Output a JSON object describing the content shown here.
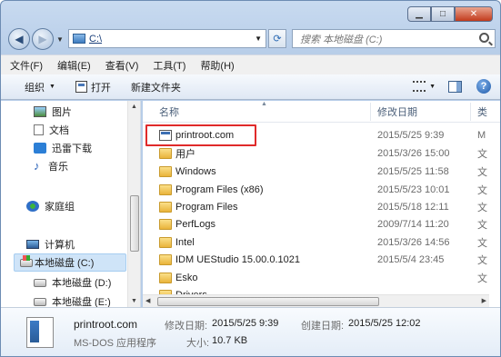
{
  "address": {
    "path": "C:\\"
  },
  "search": {
    "placeholder": "搜索 本地磁盘 (C:)"
  },
  "menu": [
    "文件(F)",
    "编辑(E)",
    "查看(V)",
    "工具(T)",
    "帮助(H)"
  ],
  "commands": {
    "organize": "组织",
    "open": "打开",
    "new_folder": "新建文件夹"
  },
  "nav_items": {
    "pictures": "图片",
    "documents": "文档",
    "xunlei": "迅雷下载",
    "music": "音乐",
    "homegroup": "家庭组",
    "computer": "计算机",
    "drive_c": "本地磁盘 (C:)",
    "drive_d": "本地磁盘 (D:)",
    "drive_e": "本地磁盘 (E:)"
  },
  "columns": {
    "name": "名称",
    "date": "修改日期",
    "type": "类"
  },
  "files": [
    {
      "name": "printroot.com",
      "date": "2015/5/25 9:39",
      "type": "M"
    },
    {
      "name": "用户",
      "date": "2015/3/26 15:00",
      "type": "文"
    },
    {
      "name": "Windows",
      "date": "2015/5/25 11:58",
      "type": "文"
    },
    {
      "name": "Program Files (x86)",
      "date": "2015/5/23 10:01",
      "type": "文"
    },
    {
      "name": "Program Files",
      "date": "2015/5/18 12:11",
      "type": "文"
    },
    {
      "name": "PerfLogs",
      "date": "2009/7/14 11:20",
      "type": "文"
    },
    {
      "name": "Intel",
      "date": "2015/3/26 14:56",
      "type": "文"
    },
    {
      "name": "IDM UEStudio 15.00.0.1021",
      "date": "2015/5/4 23:45",
      "type": "文"
    },
    {
      "name": "Esko",
      "date": "",
      "type": "文"
    },
    {
      "name": "Drivers",
      "date": "",
      "type": ""
    }
  ],
  "details": {
    "name": "printroot.com",
    "kind": "MS-DOS 应用程序",
    "modified_label": "修改日期:",
    "modified_value": "2015/5/25 9:39",
    "created_label": "创建日期:",
    "created_value": "2015/5/25 12:02",
    "size_label": "大小:",
    "size_value": "10.7 KB"
  }
}
